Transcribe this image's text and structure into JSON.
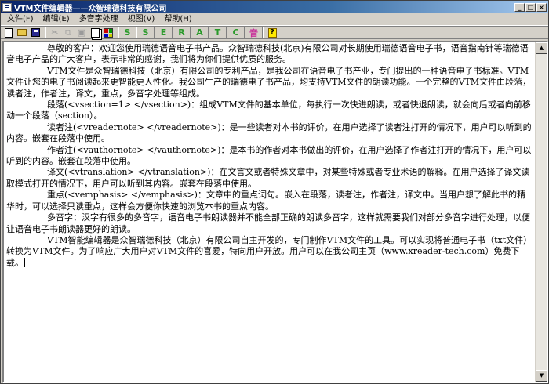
{
  "window": {
    "title": "VTM文件编辑器——众智瑞德科技有限公司",
    "min_label": "_",
    "max_label": "□",
    "close_label": "×"
  },
  "menu": {
    "items": [
      {
        "label": "文件(F)"
      },
      {
        "label": "编辑(E)"
      },
      {
        "label": "多音字处理"
      },
      {
        "label": "视图(V)"
      },
      {
        "label": "帮助(H)"
      }
    ]
  },
  "toolbar": {
    "letters": [
      {
        "label": "S",
        "color": "#2a9a2a"
      },
      {
        "label": "S",
        "color": "#2a9a2a"
      },
      {
        "label": "E",
        "color": "#2a9a2a"
      },
      {
        "label": "R",
        "color": "#2a9a2a"
      },
      {
        "label": "A",
        "color": "#2a9a2a"
      },
      {
        "label": "T",
        "color": "#2a9a2a"
      },
      {
        "label": "C",
        "color": "#2a9a2a"
      },
      {
        "label": "音",
        "color": "#c8329a"
      }
    ]
  },
  "document": {
    "paragraphs": [
      "尊敬的客户：欢迎您使用瑞德语音电子书产品。众智瑞德科技(北京)有限公司对长期使用瑞德语音电子书，语音指南针等瑞德语音电子产品的广大客户，表示非常的感谢，我们将为你们提供优质的服务。",
      "VTM文件是众智瑞德科技（北京）有限公司的专利产品，是我公司在语音电子书产业，专门提出的一种语音电子书标准。VTM文件让您的电子书阅读起来更智能更人性化。我公司生产的瑞德电子书产品，均支持VTM文件的朗读功能。一个完整的VTM文件由段落，读者注，作者注，译文，重点，多音字处理等组成。",
      "段落(<vsection=1>  </vsection>)：组成VTM文件的基本单位，每执行一次快进朗读，或者快退朗读，就会向后或者向前移动一个段落（section）。",
      "读者注(<vreadernote>  </vreadernote>)：是一些读者对本书的评价，在用户选择了读者注打开的情况下，用户可以听到的内容。嵌套在段落中使用。",
      "作者注(<vauthornote>  </vauthornote>)：是本书的作者对本书做出的评价，在用户选择了作者注打开的情况下，用户可以听到的内容。嵌套在段落中使用。",
      "译文(<vtranslation>  </vtranslation>)：在文言文或者特殊文章中，对某些特殊或者专业术语的解释。在用户选择了译文读取模式打开的情况下，用户可以听到其内容。嵌套在段落中使用。",
      "重点(<vemphasis>  </vemphasis>)：文章中的重点词句。嵌入在段落，读者注，作者注，译文中。当用户想了解此书的精华时，可以选择只读重点，这样会方便你快速的浏览本书的重点内容。",
      "多音字：汉字有很多的多音字，语音电子书朗读器并不能全部正确的朗读多音字，这样就需要我们对部分多音字进行处理，以便让语音电子书朗读器更好的朗读。",
      "VTM智能编辑器是众智瑞德科技（北京）有限公司自主开发的，专门制作VTM文件的工具。可以实现将普通电子书（txt文件）转换为VTM文件。为了响应广大用户对VTM文件的喜爱，特向用户开放。用户可以在我公司主页（www.xreader-tech.com）免费下载。"
    ]
  }
}
